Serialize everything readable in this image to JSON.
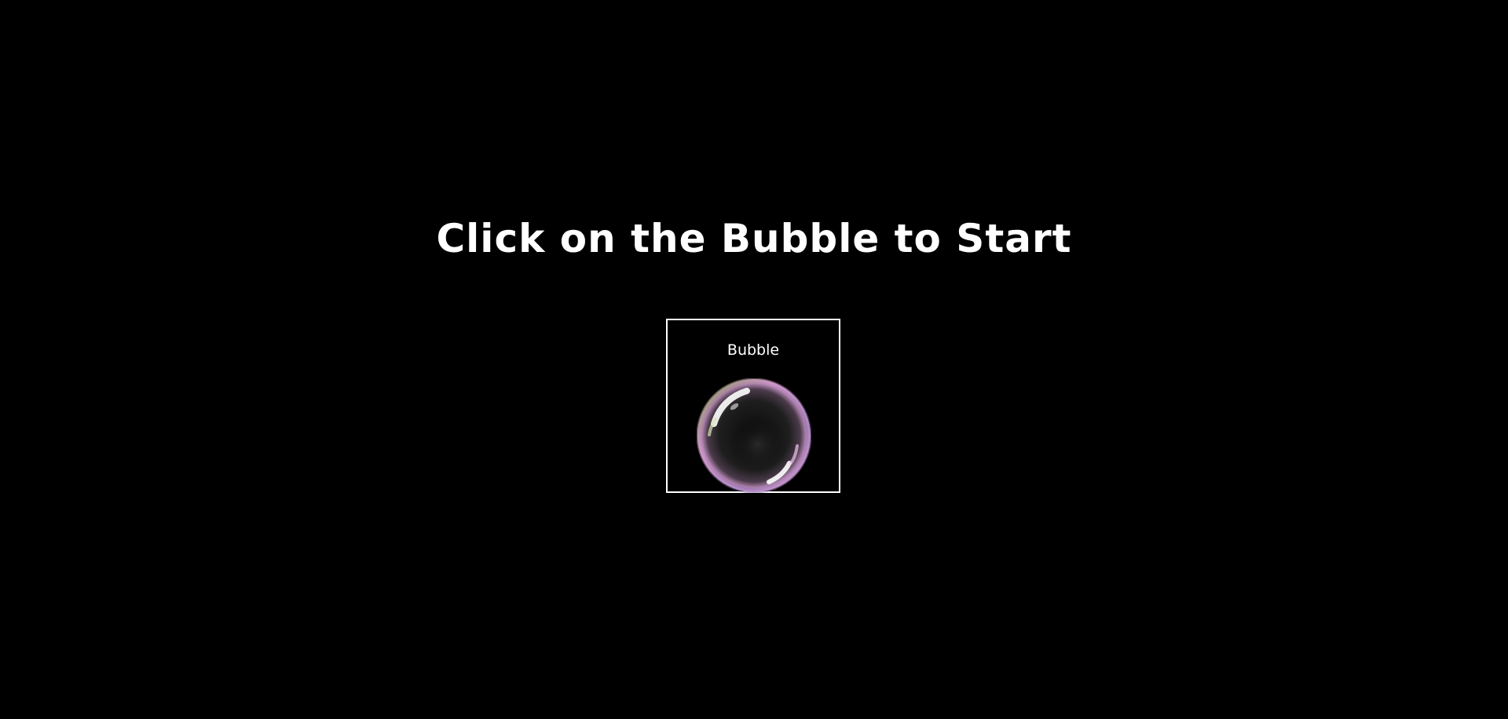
{
  "screen": {
    "background_color": "#000000",
    "text_color": "#ffffff"
  },
  "start_prompt": {
    "text": "Click on the Bubble to Start"
  },
  "bubble_option": {
    "label": "Bubble",
    "icon": "soap-bubble-icon",
    "border_color": "#ffffff"
  }
}
